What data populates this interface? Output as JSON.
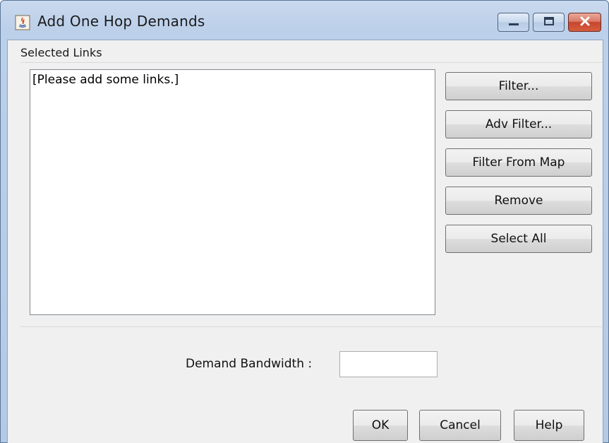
{
  "window": {
    "title": "Add One Hop Demands",
    "icon": "java-app-icon",
    "caption_buttons": [
      "minimize-icon",
      "maximize-icon",
      "close-icon"
    ]
  },
  "selected_links": {
    "group_label": "Selected Links",
    "items": [
      "[Please add some links.]"
    ]
  },
  "side_buttons": {
    "filter": "Filter...",
    "adv_filter": "Adv Filter...",
    "filter_from_map": "Filter From Map",
    "remove": "Remove",
    "select_all": "Select All"
  },
  "bandwidth": {
    "label": "Demand Bandwidth :",
    "value": ""
  },
  "footer": {
    "ok": "OK",
    "cancel": "Cancel",
    "help": "Help"
  },
  "colors": {
    "frame": "#bcd0ea",
    "client_bg": "#f0f0f0",
    "close_button": "#c7472f"
  }
}
